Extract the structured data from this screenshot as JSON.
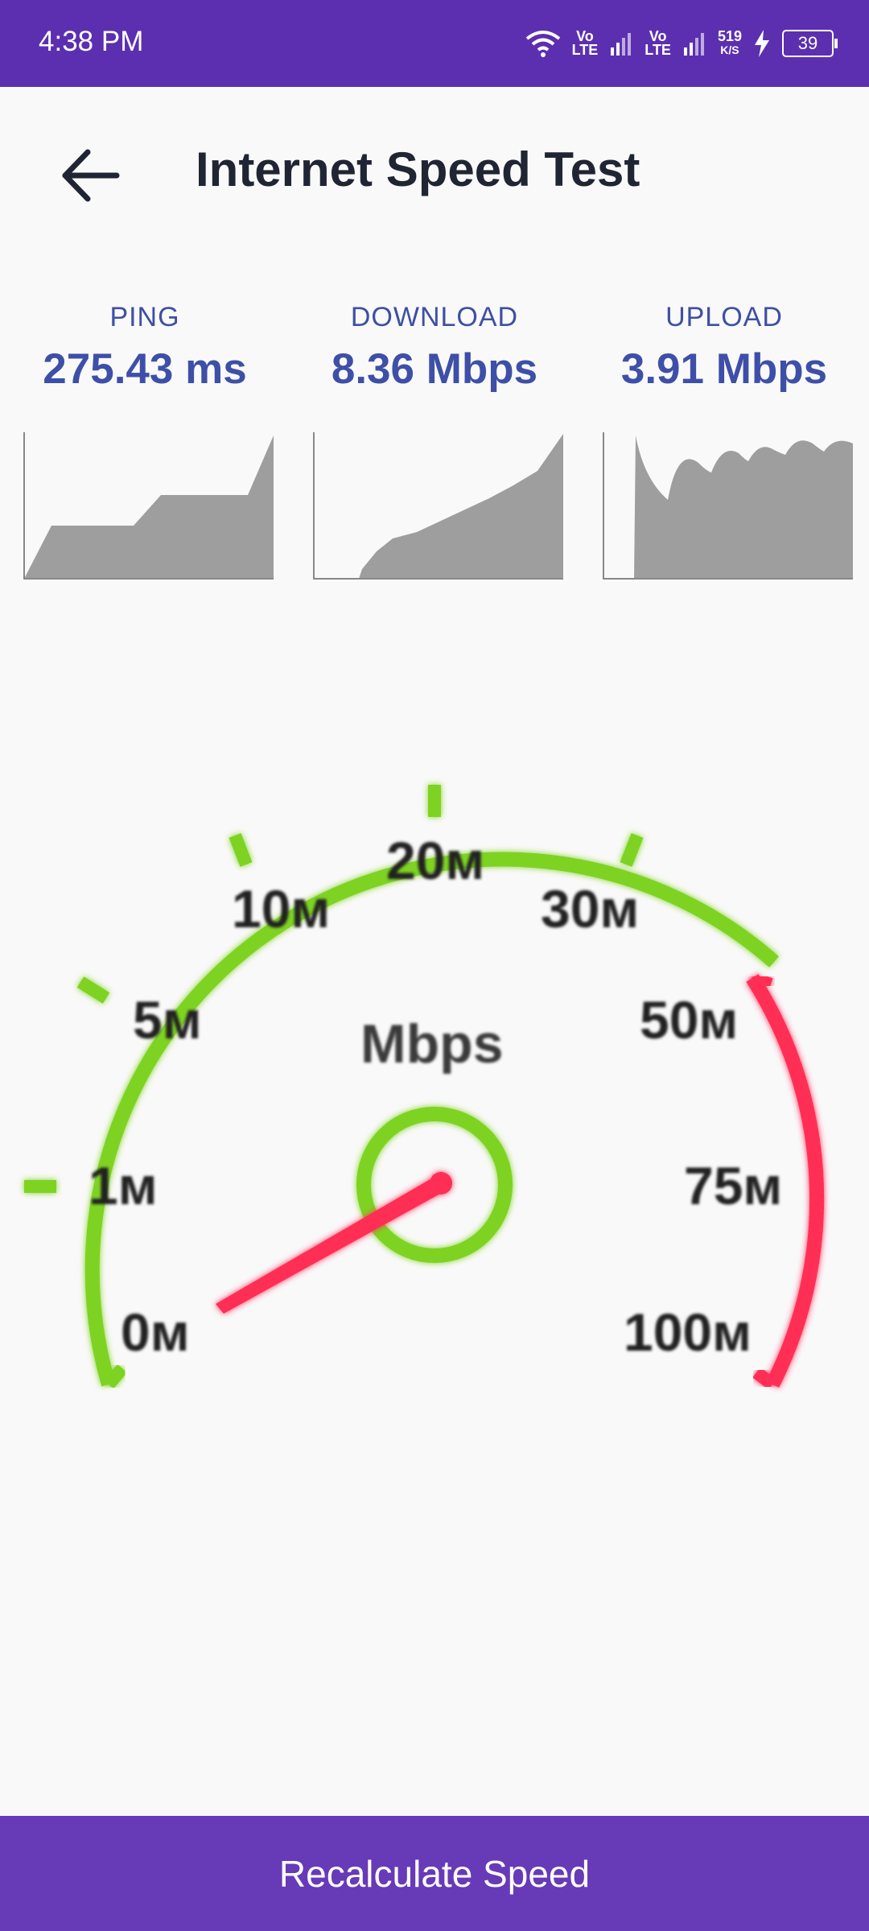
{
  "status_bar": {
    "time": "4:38 PM",
    "network_label_1": "Vo\nLTE",
    "network_label_2": "Vo\nLTE",
    "speed_value": "519",
    "speed_unit": "K/S",
    "battery": "39"
  },
  "header": {
    "title": "Internet Speed Test",
    "back_icon": "arrow-left-icon"
  },
  "stats": {
    "ping": {
      "label": "PING",
      "value": "275.43 ms"
    },
    "download": {
      "label": "DOWNLOAD",
      "value": "8.36 Mbps"
    },
    "upload": {
      "label": "UPLOAD",
      "value": "3.91 Mbps"
    }
  },
  "gauge": {
    "unit": "Mbps",
    "ticks": [
      "0м",
      "1м",
      "5м",
      "10м",
      "20м",
      "30м",
      "50м",
      "75м",
      "100м"
    ],
    "needle_value_mbps": 0
  },
  "colors": {
    "status_bar": "#5c2fb0",
    "accent_text": "#3e4fa8",
    "button": "#673ab7",
    "gauge_green": "#7ed321",
    "gauge_red": "#ff2d55",
    "graph_fill": "#9e9e9e"
  },
  "footer": {
    "recalculate_label": "Recalculate Speed"
  }
}
